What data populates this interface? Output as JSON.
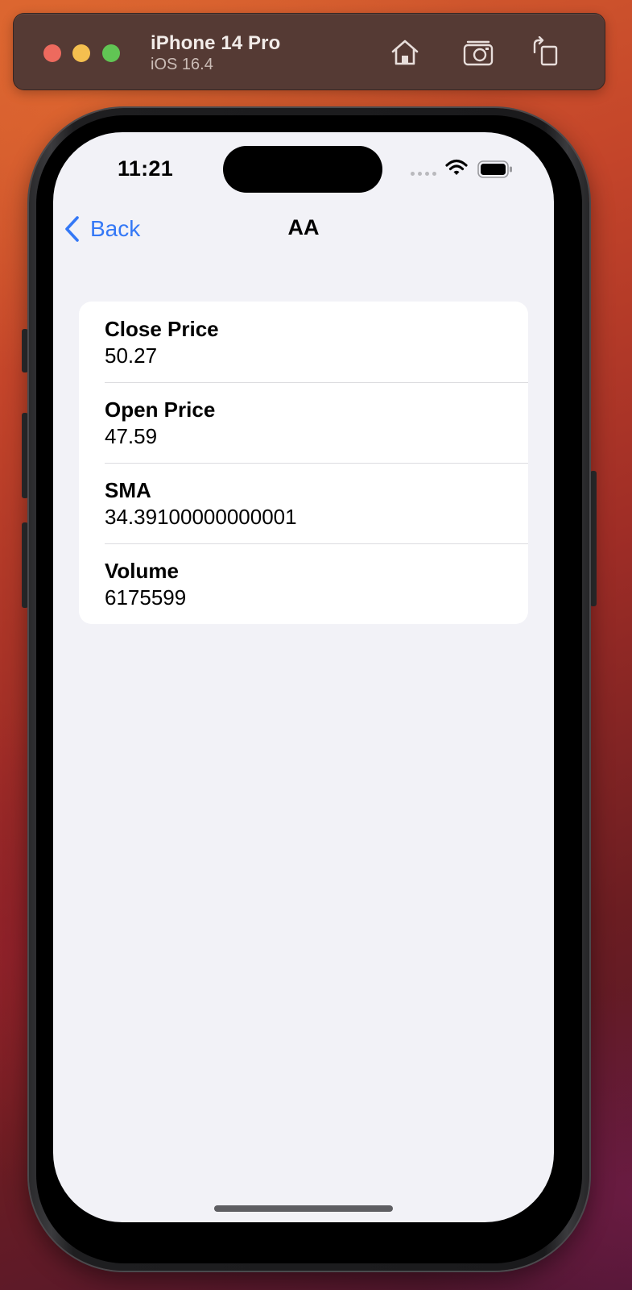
{
  "simulator": {
    "device_name": "iPhone 14 Pro",
    "os_version": "iOS 16.4",
    "toolbar_icons": [
      "home-icon",
      "screenshot-icon",
      "rotate-icon"
    ]
  },
  "status_bar": {
    "time": "11:21",
    "icons": [
      "cellular-signal-icon",
      "wifi-icon",
      "battery-icon"
    ]
  },
  "nav": {
    "back_label": "Back",
    "title": "AA",
    "accent_color": "#3478F6"
  },
  "details": [
    {
      "label": "Close Price",
      "value": "50.27"
    },
    {
      "label": "Open Price",
      "value": "47.59"
    },
    {
      "label": "SMA",
      "value": "34.39100000000001"
    },
    {
      "label": "Volume",
      "value": "6175599"
    }
  ]
}
